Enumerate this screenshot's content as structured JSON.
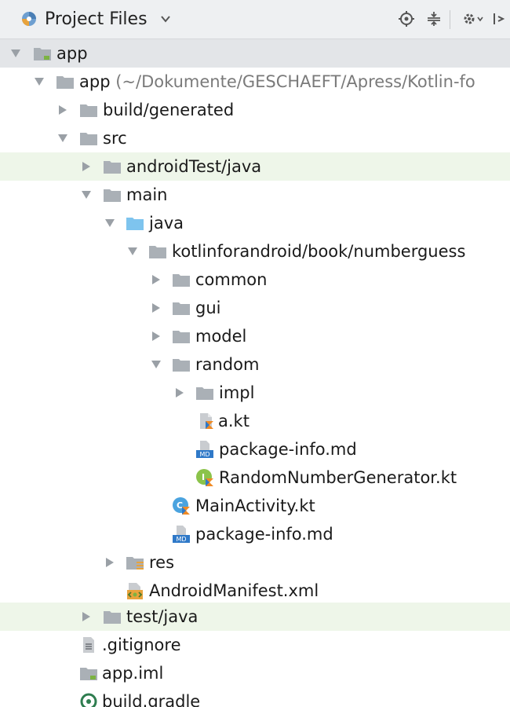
{
  "header": {
    "title": "Project Files",
    "icons": [
      "project-icon",
      "chevron-down-icon",
      "locate-icon",
      "collapse-all-icon",
      "settings-icon",
      "hide-icon"
    ]
  },
  "tree": [
    {
      "label": "app",
      "icon": "module-folder-icon",
      "expanded": true
    },
    {
      "label": "app",
      "path": "(~/Dokumente/GESCHAEFT/Apress/Kotlin-fo",
      "icon": "folder-icon",
      "expanded": true
    },
    {
      "label": "build/generated",
      "icon": "folder-icon",
      "expanded": false
    },
    {
      "label": "src",
      "icon": "folder-icon",
      "expanded": true
    },
    {
      "label": "androidTest/java",
      "icon": "folder-icon",
      "expanded": false
    },
    {
      "label": "main",
      "icon": "folder-icon",
      "expanded": true
    },
    {
      "label": "java",
      "icon": "source-folder-icon",
      "expanded": true
    },
    {
      "label": "kotlinforandroid/book/numberguess",
      "icon": "package-folder-icon",
      "expanded": true
    },
    {
      "label": "common",
      "icon": "folder-icon",
      "expanded": false
    },
    {
      "label": "gui",
      "icon": "folder-icon",
      "expanded": false
    },
    {
      "label": "model",
      "icon": "folder-icon",
      "expanded": false
    },
    {
      "label": "random",
      "icon": "folder-icon",
      "expanded": true
    },
    {
      "label": "impl",
      "icon": "folder-icon",
      "expanded": false
    },
    {
      "label": "a.kt",
      "icon": "kotlin-file-icon"
    },
    {
      "label": "package-info.md",
      "icon": "markdown-file-icon"
    },
    {
      "label": "RandomNumberGenerator.kt",
      "icon": "kotlin-interface-icon"
    },
    {
      "label": "MainActivity.kt",
      "icon": "kotlin-class-icon"
    },
    {
      "label": "package-info.md",
      "icon": "markdown-file-icon"
    },
    {
      "label": "res",
      "icon": "resources-folder-icon",
      "expanded": false
    },
    {
      "label": "AndroidManifest.xml",
      "icon": "manifest-file-icon"
    },
    {
      "label": "test/java",
      "icon": "folder-icon",
      "expanded": false
    },
    {
      "label": ".gitignore",
      "icon": "text-file-icon"
    },
    {
      "label": "app.iml",
      "icon": "module-file-icon"
    },
    {
      "label": "build.gradle",
      "icon": "gradle-file-icon"
    }
  ],
  "colors": {
    "highlight_row": "#eef6e9",
    "root_row": "#e3e5e8",
    "header_bg": "#eef0f2",
    "folder": "#aab0b6",
    "source_folder": "#7ec4ee",
    "kotlin_orange": "#f08a24",
    "kotlin_blue": "#2f79c8"
  }
}
